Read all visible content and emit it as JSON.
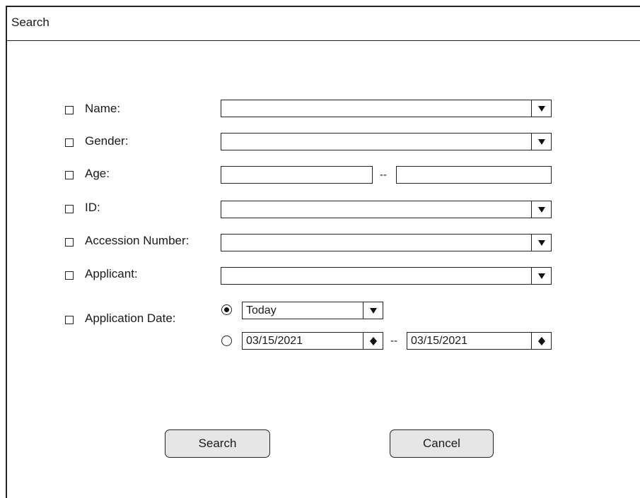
{
  "window": {
    "title": "Search"
  },
  "form": {
    "name": {
      "label": "Name:",
      "value": ""
    },
    "gender": {
      "label": "Gender:",
      "value": ""
    },
    "age": {
      "label": "Age:",
      "separator": "--",
      "from": "",
      "to": ""
    },
    "id": {
      "label": "ID:",
      "value": ""
    },
    "accession": {
      "label": "Accession Number:",
      "value": ""
    },
    "applicant": {
      "label": "Applicant:",
      "value": ""
    },
    "application_date": {
      "label": "Application Date:",
      "preset_value": "Today",
      "preset_selected": true,
      "range_selected": false,
      "from": "03/15/2021",
      "separator": "--",
      "to": "03/15/2021"
    }
  },
  "buttons": {
    "search": "Search",
    "cancel": "Cancel"
  },
  "icons": {
    "dropdown": "chevron-down-icon",
    "spinner": "up-down-icon"
  }
}
